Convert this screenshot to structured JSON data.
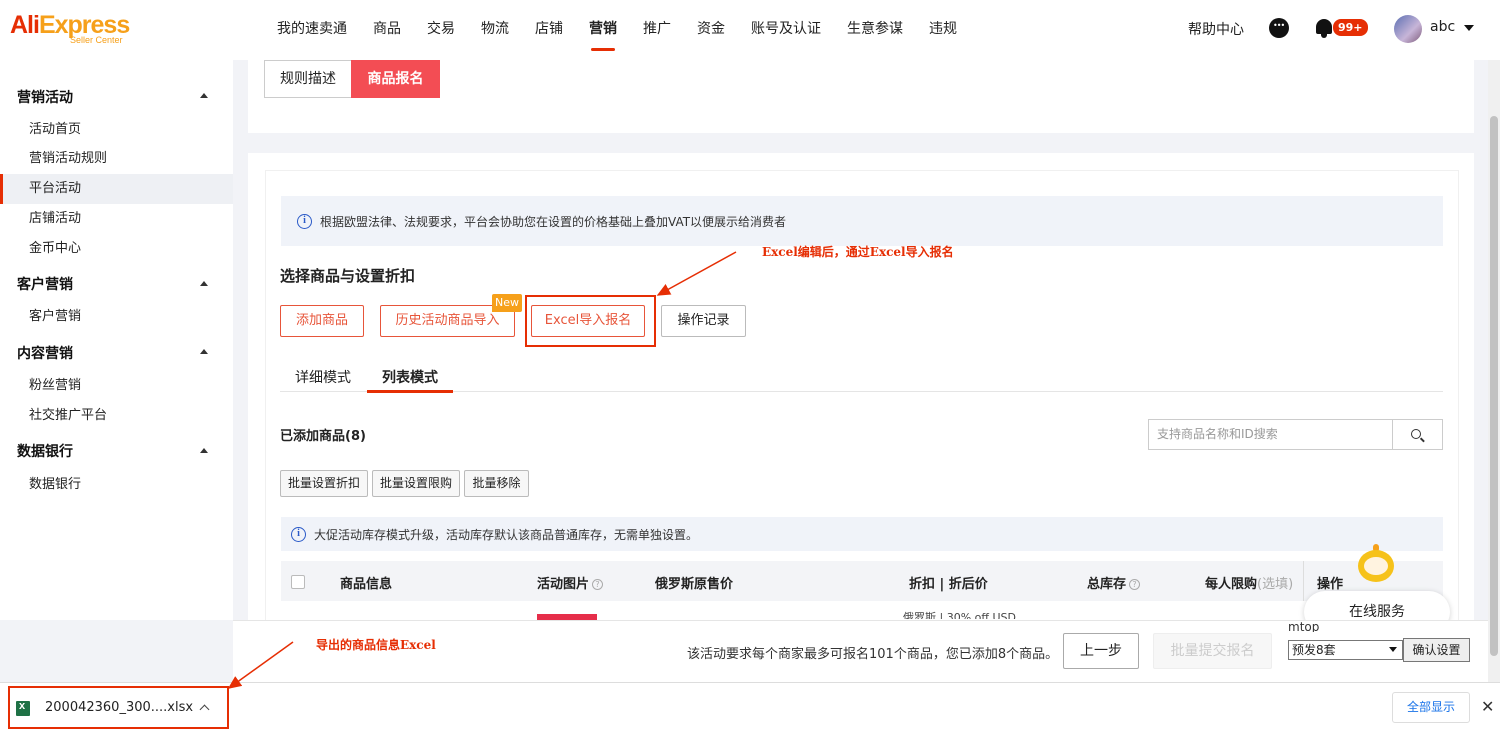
{
  "header": {
    "logo_main": "AliExpress",
    "logo_sub": "Seller Center",
    "nav": [
      "我的速卖通",
      "商品",
      "交易",
      "物流",
      "店铺",
      "营销",
      "推广",
      "资金",
      "账号及认证",
      "生意参谋",
      "违规"
    ],
    "nav_active": "营销",
    "help": "帮助中心",
    "badge": "99+",
    "user": "abc"
  },
  "sidebar": {
    "groups": [
      {
        "title": "营销活动",
        "items": [
          "活动首页",
          "营销活动规则",
          "平台活动",
          "店铺活动",
          "金币中心"
        ]
      },
      {
        "title": "客户营销",
        "items": [
          "客户营销"
        ]
      },
      {
        "title": "内容营销",
        "items": [
          "粉丝营销",
          "社交推广平台"
        ]
      },
      {
        "title": "数据银行",
        "items": [
          "数据银行"
        ]
      }
    ],
    "active_item": "平台活动"
  },
  "tabs": {
    "rules": "规则描述",
    "signup": "商品报名"
  },
  "notice": "根据欧盟法律、法规要求，平台会协助您在设置的价格基础上叠加VAT以便展示给消费者",
  "section_title": "选择商品与设置折扣",
  "buttons": {
    "add_product": "添加商品",
    "history_import": "历史活动商品导入",
    "new_badge": "New",
    "excel_import": "Excel导入报名",
    "op_log": "操作记录"
  },
  "modes": {
    "detail": "详细模式",
    "list": "列表模式"
  },
  "added_label": "已添加商品(8)",
  "search_placeholder": "支持商品名称和ID搜索",
  "batch": {
    "discount": "批量设置折扣",
    "limit": "批量设置限购",
    "remove": "批量移除"
  },
  "notice2": "大促活动库存模式升级，活动库存默认该商品普通库存，无需单独设置。",
  "table_headers": {
    "product_info": "商品信息",
    "activity_image": "活动图片",
    "ru_price": "俄罗斯原售价",
    "discount": "折扣 | 折后价",
    "total_stock": "总库存",
    "per_limit": "每人限购",
    "per_limit_opt": "(选填)",
    "action": "操作"
  },
  "row_partial": "俄罗斯 | 30% off USD",
  "service": "在线服务",
  "footer": {
    "limit_text": "该活动要求每个商家最多可报名101个商品，您已添加8个商品。",
    "prev": "上一步",
    "submit": "批量提交报名",
    "mtop": "mtop",
    "select_value": "预发8套",
    "confirm": "确认设置"
  },
  "download": {
    "filename": "200042360_300....xlsx",
    "show_all": "全部显示"
  },
  "annotations": {
    "excel_note": "Excel编辑后，通过Excel导入报名",
    "export_note": "导出的商品信息Excel"
  },
  "colors": {
    "brand": "#e62e04",
    "accent": "#f34d54",
    "new_badge": "#f6a01a"
  }
}
